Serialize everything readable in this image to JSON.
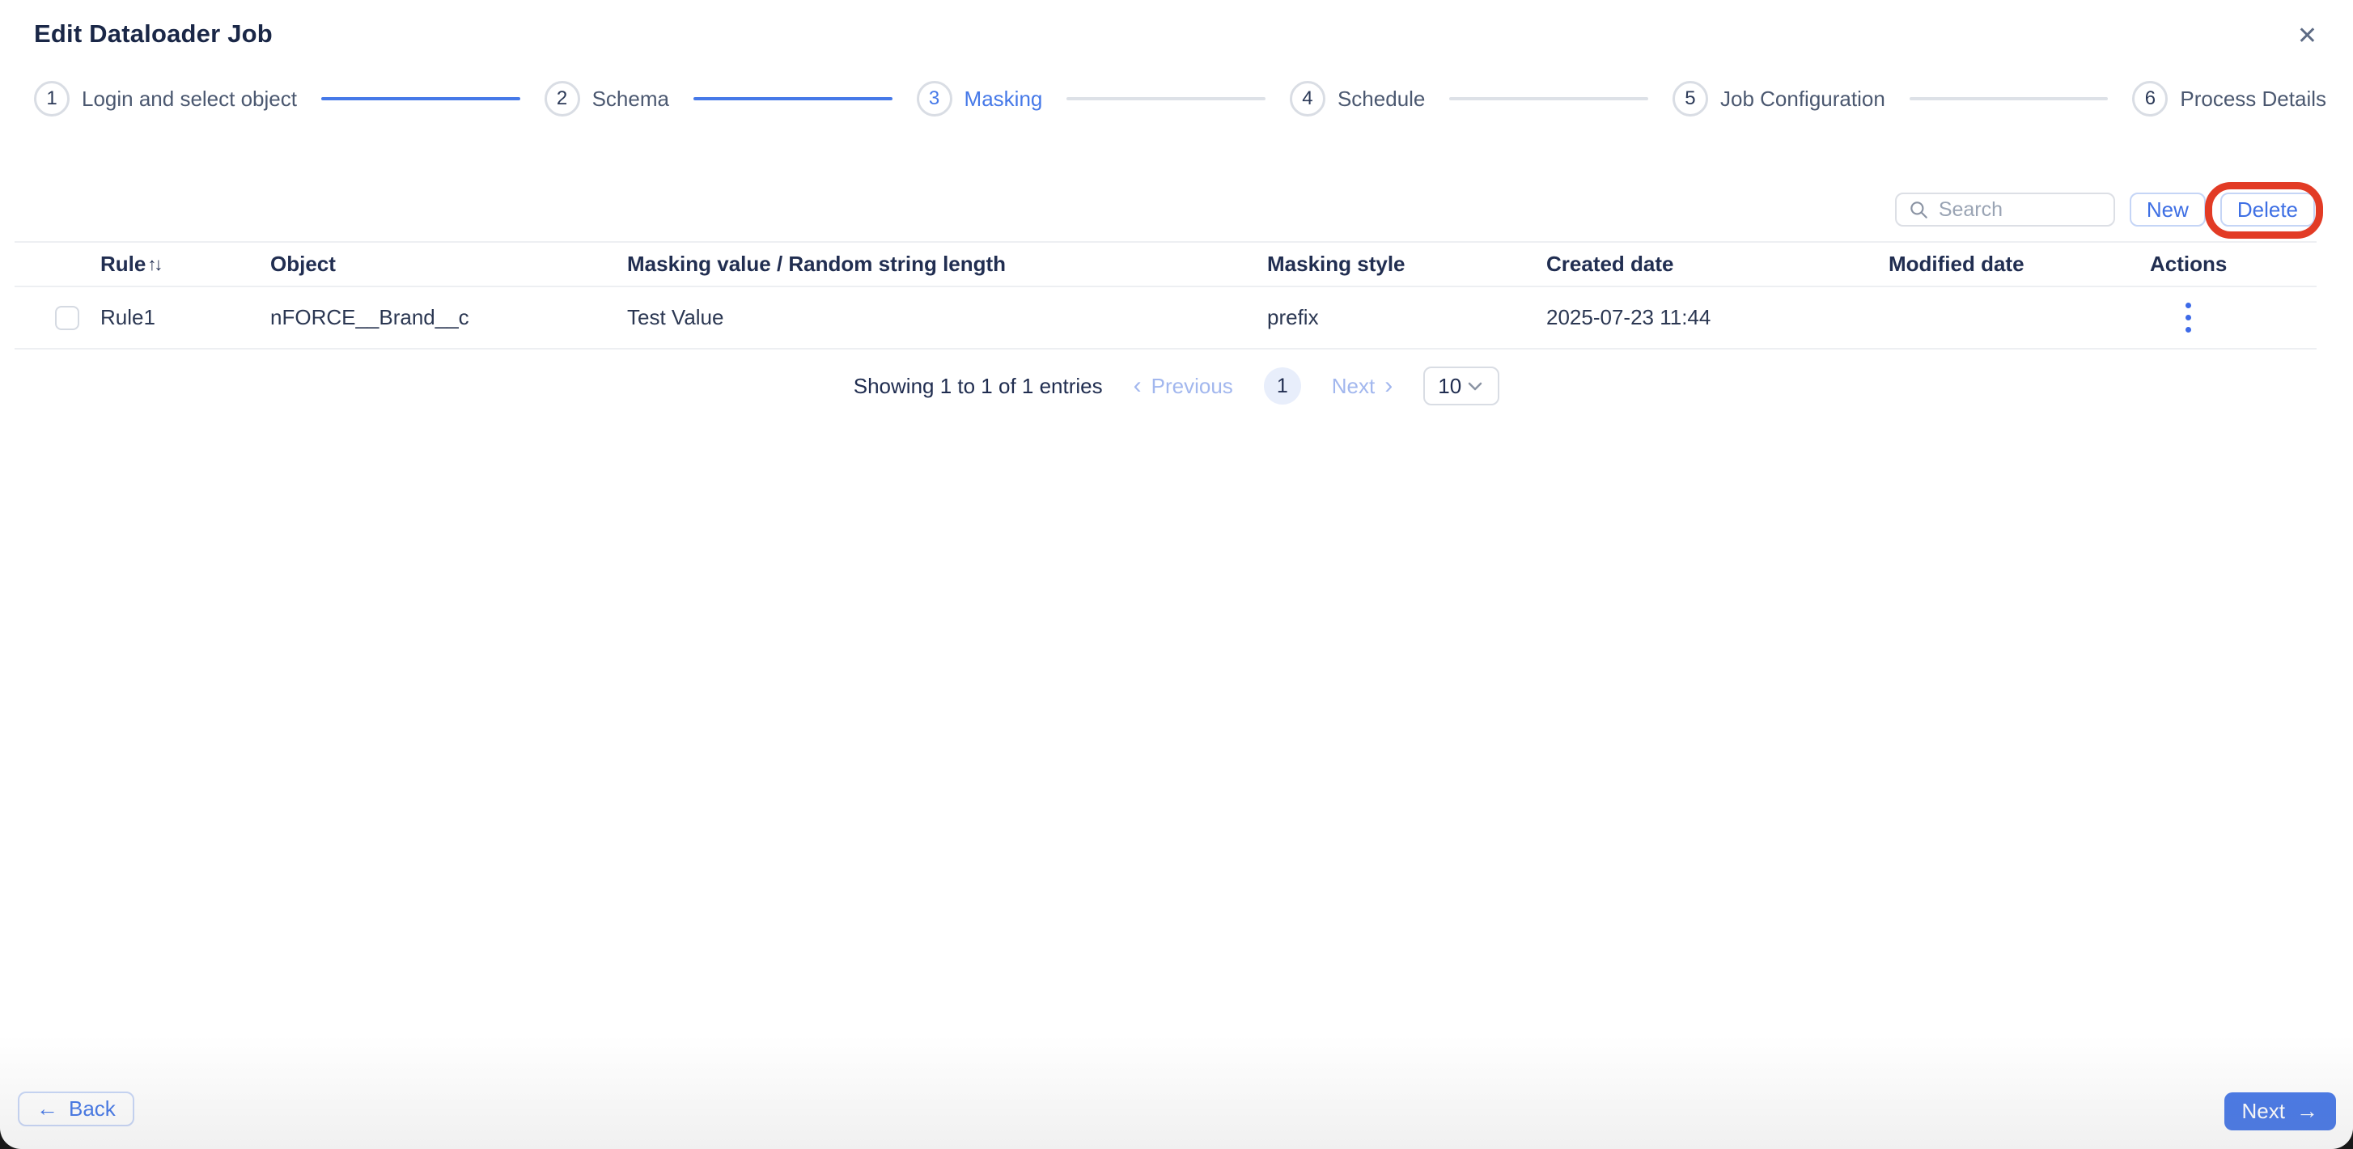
{
  "window": {
    "title": "Edit Dataloader Job"
  },
  "icons": {
    "close": "✕",
    "sort_up": "↑",
    "sort_down": "↓",
    "chevron_left": "‹",
    "chevron_right": "›",
    "arrow_left": "←",
    "arrow_right": "→"
  },
  "stepper": {
    "steps": [
      {
        "number": "1",
        "label": "Login and select object",
        "state": "completed"
      },
      {
        "number": "2",
        "label": "Schema",
        "state": "completed"
      },
      {
        "number": "3",
        "label": "Masking",
        "state": "active"
      },
      {
        "number": "4",
        "label": "Schedule",
        "state": "upcoming"
      },
      {
        "number": "5",
        "label": "Job Configuration",
        "state": "upcoming"
      },
      {
        "number": "6",
        "label": "Process Details",
        "state": "upcoming"
      }
    ]
  },
  "toolbar": {
    "search_placeholder": "Search",
    "new_label": "New",
    "delete_label": "Delete"
  },
  "table": {
    "columns": [
      "Rule",
      "Object",
      "Masking value / Random string length",
      "Masking style",
      "Created date",
      "Modified date",
      "Actions"
    ],
    "rows": [
      {
        "rule": "Rule1",
        "object": "nFORCE__Brand__c",
        "masking_value": "Test Value",
        "masking_style": "prefix",
        "created_date": "2025-07-23 11:44",
        "modified_date": ""
      }
    ]
  },
  "pagination": {
    "summary": "Showing 1 to 1 of 1 entries",
    "previous_label": "Previous",
    "current_page": "1",
    "next_label": "Next",
    "page_size": "10"
  },
  "footer": {
    "back_label": "Back",
    "next_label": "Next"
  },
  "colors": {
    "accent_blue": "#4679e8",
    "disabled_blue": "#a2b7ee",
    "dark_navy": "#1a2747",
    "border_gray": "#dcdfe5",
    "annotation_red": "#e23b25"
  }
}
